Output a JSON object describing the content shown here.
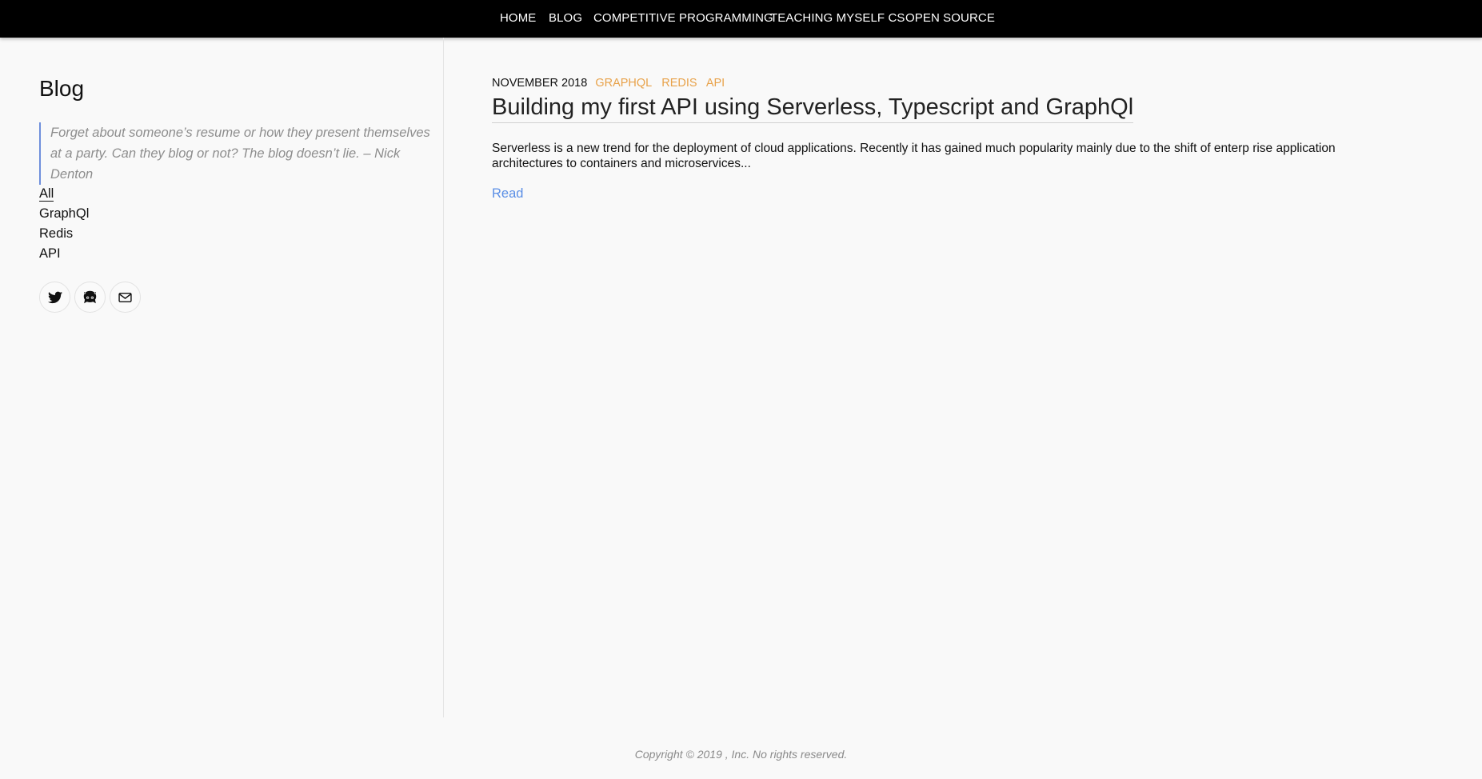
{
  "nav": {
    "items": [
      {
        "label": "HOME"
      },
      {
        "label": "BLOG"
      },
      {
        "label": "COMPETITIVE PROGRAMMING"
      },
      {
        "label": "TEACHING MYSELF CS"
      },
      {
        "label": "OPEN SOURCE"
      }
    ]
  },
  "sidebar": {
    "title": "Blog",
    "quote": "Forget about someone’s resume or how they present themselves at a party. Can they blog or not? The blog doesn’t lie. – Nick Denton",
    "tags": [
      {
        "label": "All",
        "active": true
      },
      {
        "label": "GraphQl",
        "active": false
      },
      {
        "label": "Redis",
        "active": false
      },
      {
        "label": "API",
        "active": false
      }
    ],
    "social": [
      {
        "icon": "twitter-icon"
      },
      {
        "icon": "github-icon"
      },
      {
        "icon": "mail-icon"
      }
    ]
  },
  "post": {
    "date": "NOVEMBER 2018",
    "tags": [
      "GRAPHQL",
      "REDIS",
      "API"
    ],
    "title": "Building my first API using Serverless, Typescript and GraphQl",
    "excerpt": "Serverless is a new trend for the deployment of cloud applications. Recently it has gained much popularity mainly due to the shift of enterp rise application architectures to containers and microservices...",
    "read_label": "Read"
  },
  "footer": {
    "copyright": "Copyright © 2019 , Inc. No rights reserved."
  },
  "colors": {
    "nav_bg": "#000000",
    "tag_accent": "#e8a24a",
    "link": "#5b8fe6",
    "quote_border": "#6f8fdc"
  }
}
